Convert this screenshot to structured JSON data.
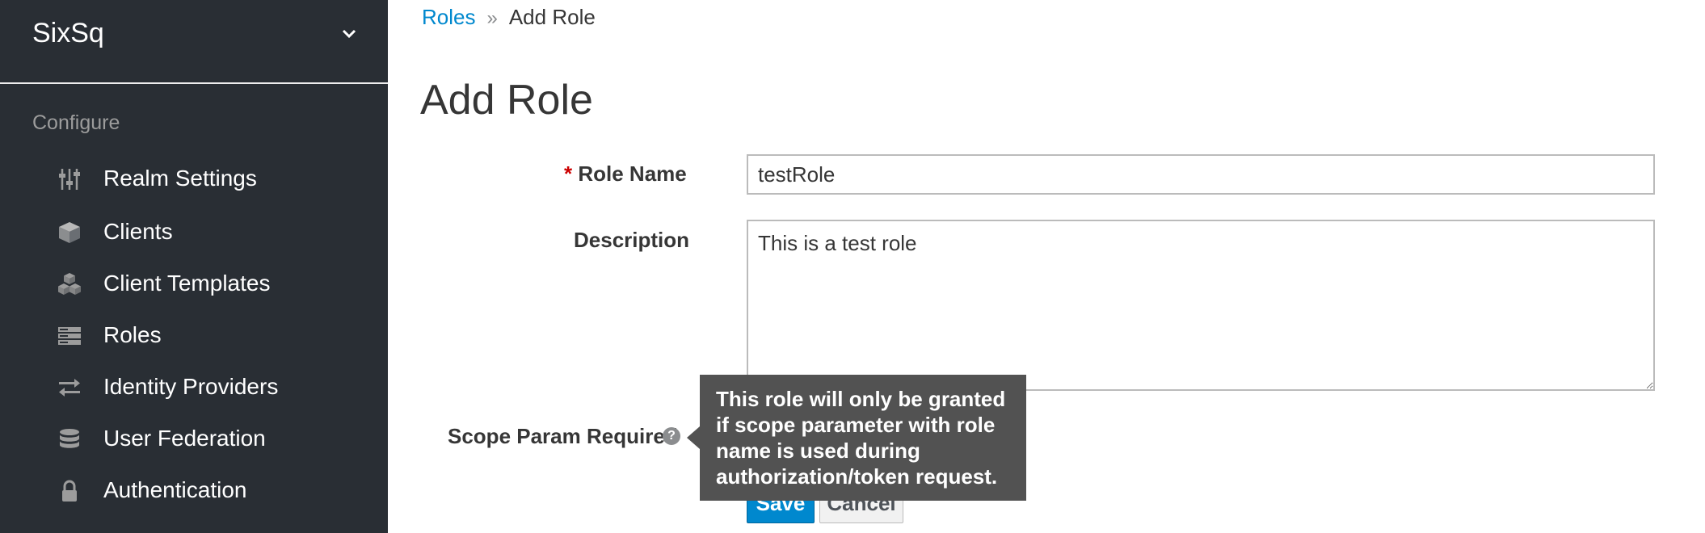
{
  "sidebar": {
    "realm_name": "SixSq",
    "section_title": "Configure",
    "items": [
      {
        "label": "Realm Settings",
        "icon": "sliders-icon"
      },
      {
        "label": "Clients",
        "icon": "cube-icon"
      },
      {
        "label": "Client Templates",
        "icon": "cubes-icon"
      },
      {
        "label": "Roles",
        "icon": "server-icon"
      },
      {
        "label": "Identity Providers",
        "icon": "exchange-icon"
      },
      {
        "label": "User Federation",
        "icon": "database-icon"
      },
      {
        "label": "Authentication",
        "icon": "lock-icon"
      }
    ]
  },
  "breadcrumb": {
    "parent": "Roles",
    "separator": "»",
    "current": "Add Role"
  },
  "page": {
    "title": "Add Role"
  },
  "form": {
    "role_name": {
      "required_marker": "*",
      "label": "Role Name",
      "value": "testRole"
    },
    "description": {
      "label": "Description",
      "value": "This is a test role"
    },
    "scope_param": {
      "label": "Scope Param Required",
      "help_glyph": "?"
    },
    "save_label": "Save",
    "cancel_label": "Cancel"
  },
  "tooltip": {
    "text": "This role will only be granted if scope parameter with role name is used during authorization/token request."
  },
  "colors": {
    "sidebar_bg": "#292e34",
    "link": "#0088ce",
    "primary_button": "#0088ce",
    "required": "#cc0000",
    "tooltip_bg": "#525252"
  }
}
